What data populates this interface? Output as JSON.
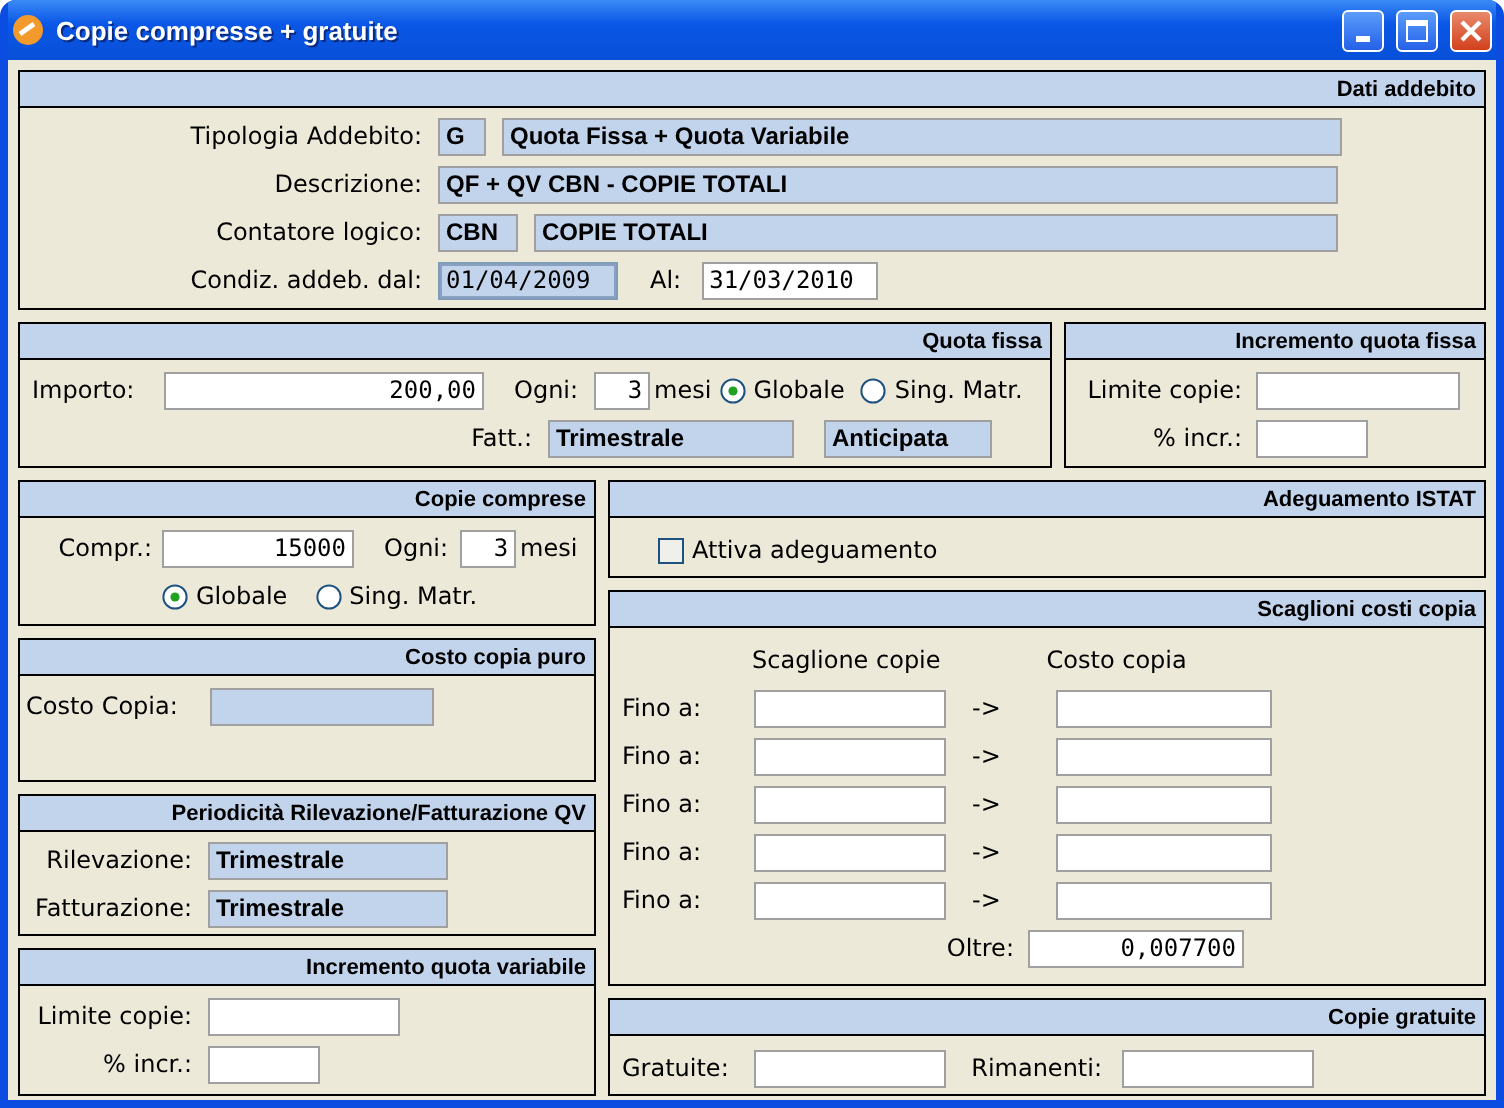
{
  "window": {
    "title": "Copie compresse + gratuite"
  },
  "dati_addebito": {
    "title": "Dati addebito",
    "rows": [
      {
        "label": "Tipologia Addebito:",
        "fields": [
          {
            "value": "G",
            "kind": "filled"
          },
          {
            "value": "Quota Fissa + Quota Variabile",
            "kind": "filled"
          }
        ]
      },
      {
        "label": "Descrizione:",
        "fields": [
          {
            "value": "QF + QV CBN  - COPIE TOTALI",
            "kind": "filled"
          }
        ]
      },
      {
        "label": "Contatore logico:",
        "fields": [
          {
            "value": "CBN",
            "kind": "filled"
          },
          {
            "value": "COPIE TOTALI",
            "kind": "filled"
          }
        ]
      }
    ],
    "date_label": "Condiz. addeb. dal:",
    "date_from": {
      "value": "01/04/2009",
      "kind": "locked"
    },
    "to_label": "Al:",
    "date_to": {
      "value": "31/03/2010",
      "kind": "entry"
    }
  },
  "quota_fissa": {
    "title": "Quota fissa",
    "importo_label": "Importo:",
    "importo": {
      "value": "200,00",
      "kind": "entry"
    },
    "ogni_label": "Ogni:",
    "ogni": {
      "value": "3",
      "kind": "entry"
    },
    "unit": "mesi",
    "options": [
      {
        "label": "Globale",
        "selected": true
      },
      {
        "label": "Sing. Matr.",
        "selected": false
      }
    ],
    "fatt_label": "Fatt.:",
    "fatt": [
      {
        "value": "Trimestrale",
        "kind": "filled"
      },
      {
        "value": "Anticipata",
        "kind": "filled"
      }
    ]
  },
  "incremento_quota_fissa": {
    "title": "Incremento  quota fissa",
    "limite_label": "Limite copie:",
    "limite": {
      "kind": "entry"
    },
    "incr_label": "% incr.:",
    "incr": {
      "kind": "entry"
    }
  },
  "copie_comprese": {
    "title": "Copie comprese",
    "compr_label": "Compr.:",
    "compr": {
      "value": "15000",
      "kind": "entry"
    },
    "ogni_label": "Ogni:",
    "ogni": {
      "value": "3",
      "kind": "entry"
    },
    "unit": "mesi",
    "options": [
      {
        "label": "Globale",
        "selected": true
      },
      {
        "label": "Sing. Matr.",
        "selected": false
      }
    ]
  },
  "costo_copia_puro": {
    "title": "Costo copia puro",
    "label": "Costo Copia:",
    "field": {
      "kind": "filled"
    }
  },
  "periodicita": {
    "title": "Periodicità Rilevazione/Fatturazione QV",
    "rows": [
      {
        "label": "Rilevazione:",
        "field": {
          "value": "Trimestrale",
          "kind": "filled"
        }
      },
      {
        "label": "Fatturazione:",
        "field": {
          "value": "Trimestrale",
          "kind": "filled"
        }
      }
    ]
  },
  "incremento_quota_variabile": {
    "title": "Incremento quota variabile",
    "limite_label": "Limite copie:",
    "limite": {
      "kind": "entry"
    },
    "incr_label": "% incr.:",
    "incr": {
      "kind": "entry"
    }
  },
  "adeguamento_istat": {
    "title": "Adeguamento ISTAT",
    "checkbox": {
      "label": "Attiva adeguamento",
      "checked": false
    }
  },
  "scaglioni": {
    "title": "Scaglioni costi copia",
    "col_1": "Scaglione copie",
    "col_2": "Costo copia",
    "rows": [
      {
        "label": "Fino a:",
        "arrow": "->"
      },
      {
        "label": "Fino a:",
        "arrow": "->"
      },
      {
        "label": "Fino a:",
        "arrow": "->"
      },
      {
        "label": "Fino a:",
        "arrow": "->"
      },
      {
        "label": "Fino a:",
        "arrow": "->"
      }
    ],
    "oltre_label": "Oltre:",
    "oltre": {
      "value": "0,007700",
      "kind": "entry"
    }
  },
  "copie_gratuite": {
    "title": "Copie gratuite",
    "gratuite_label": "Gratuite:",
    "gratuite": {
      "kind": "entry"
    },
    "rimanenti_label": "Rimanenti:",
    "rimanenti": {
      "kind": "entry"
    }
  }
}
